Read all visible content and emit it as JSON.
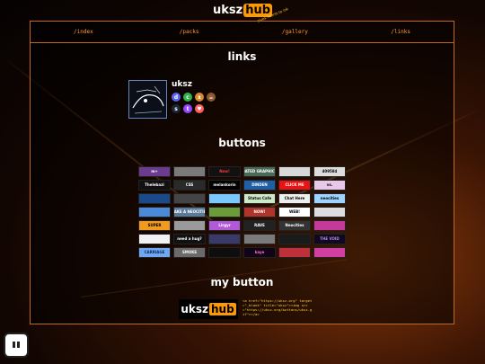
{
  "site": {
    "brand_left": "uksz",
    "brand_right": "hub",
    "tagline": "gives hearts to ink"
  },
  "nav": [
    {
      "label": "/index"
    },
    {
      "label": "/packs"
    },
    {
      "label": "/gallery"
    },
    {
      "label": "/links"
    }
  ],
  "sections": {
    "links": "links",
    "buttons": "buttons",
    "my_button": "my button"
  },
  "profile": {
    "name": "uksz",
    "icons": [
      {
        "name": "discord-icon",
        "color": "#5865f2",
        "glyph": "d"
      },
      {
        "name": "green-circle-icon",
        "color": "#2fb34a",
        "glyph": "c"
      },
      {
        "name": "orange-cat-icon",
        "color": "#d8872e",
        "glyph": "ᴥ"
      },
      {
        "name": "coffee-icon",
        "color": "#8a5a2e",
        "glyph": "☕"
      },
      {
        "name": "steam-icon",
        "color": "#1b2838",
        "glyph": "s"
      },
      {
        "name": "twitch-icon",
        "color": "#9146ff",
        "glyph": "t"
      },
      {
        "name": "kofi-icon",
        "color": "#ff5e5b",
        "glyph": "♥"
      }
    ]
  },
  "buttons_grid": [
    {
      "text": "m+",
      "bg": "#6b3b8f",
      "fg": "#fff"
    },
    {
      "text": "",
      "bg": "#7a7a7a",
      "fg": "#fff"
    },
    {
      "text": "Now!",
      "bg": "#111",
      "fg": "#ff3a3a"
    },
    {
      "text": "DATED GRAPHICS",
      "bg": "#4a6a58",
      "fg": "#fff"
    },
    {
      "text": "",
      "bg": "#d8d8d8",
      "fg": "#000"
    },
    {
      "text": "409584",
      "bg": "#ddd",
      "fg": "#000"
    },
    {
      "text": "Thelebazi",
      "bg": "#111",
      "fg": "#fff"
    },
    {
      "text": "CSS",
      "bg": "#2a2a2a",
      "fg": "#fff"
    },
    {
      "text": "melankorin",
      "bg": "#000",
      "fg": "#fff"
    },
    {
      "text": "DINDEN",
      "bg": "#1e5fa8",
      "fg": "#fff"
    },
    {
      "text": "CLICK ME",
      "bg": "#e11",
      "fg": "#fff"
    },
    {
      "text": "vs.",
      "bg": "#e8c8e8",
      "fg": "#000"
    },
    {
      "text": "",
      "bg": "#1a4a8a",
      "fg": "#fff"
    },
    {
      "text": "",
      "bg": "#444",
      "fg": "#fff"
    },
    {
      "text": "",
      "bg": "#7bc8ff",
      "fg": "#000"
    },
    {
      "text": "Status Cafe",
      "bg": "#cfe8c8",
      "fg": "#000"
    },
    {
      "text": "Chat Here",
      "bg": "#eee",
      "fg": "#000"
    },
    {
      "text": "neocities",
      "bg": "#9fd3ff",
      "fg": "#000"
    },
    {
      "text": "",
      "bg": "#4a8ad8",
      "fg": "#fff"
    },
    {
      "text": "MAKE A NEOCITIES",
      "bg": "#5a7a9a",
      "fg": "#fff"
    },
    {
      "text": "",
      "bg": "#6a9a3a",
      "fg": "#fff"
    },
    {
      "text": "NOW!",
      "bg": "#b0342a",
      "fg": "#fff"
    },
    {
      "text": "WEB!",
      "bg": "#fff",
      "fg": "#000"
    },
    {
      "text": "",
      "bg": "#ddd",
      "fg": "#000"
    },
    {
      "text": "SUPER",
      "bg": "#f09a20",
      "fg": "#000"
    },
    {
      "text": "",
      "bg": "#9a9a9a",
      "fg": "#000"
    },
    {
      "text": "Lirgyr",
      "bg": "#b15ad8",
      "fg": "#fff"
    },
    {
      "text": "RAVE",
      "bg": "#222",
      "fg": "#fff"
    },
    {
      "text": "Neocities",
      "bg": "#333",
      "fg": "#fff"
    },
    {
      "text": "",
      "bg": "#c33a9a",
      "fg": "#fff"
    },
    {
      "text": "",
      "bg": "#f2f2f2",
      "fg": "#000"
    },
    {
      "text": "need a hug?",
      "bg": "#111",
      "fg": "#fff"
    },
    {
      "text": "",
      "bg": "#3a3a6a",
      "fg": "#fff"
    },
    {
      "text": "",
      "bg": "#7a7a7a",
      "fg": "#fff"
    },
    {
      "text": "",
      "bg": "#1a1a1a",
      "fg": "#fff"
    },
    {
      "text": "THE VOID",
      "bg": "#100820",
      "fg": "#b98af0"
    },
    {
      "text": "CARRIAGE",
      "bg": "#6fa8f0",
      "fg": "#0a2a5a"
    },
    {
      "text": "SMOKE",
      "bg": "#6a6a6a",
      "fg": "#fff"
    },
    {
      "text": "",
      "bg": "#0e0e0e",
      "fg": "#fff"
    },
    {
      "text": "kaye",
      "bg": "#120418",
      "fg": "#ff6cc8"
    },
    {
      "text": "",
      "bg": "#c0303a",
      "fg": "#fff"
    },
    {
      "text": "",
      "bg": "#d13fa0",
      "fg": "#fff"
    }
  ],
  "my_button": {
    "brand_left": "uksz",
    "brand_right": "hub",
    "code": "<a href=\"https://uksz.org\" target=\"_blank\" title=\"uksz\"><img src=\"https://uksz.org/buttons/uksz.gif\"></a>"
  }
}
